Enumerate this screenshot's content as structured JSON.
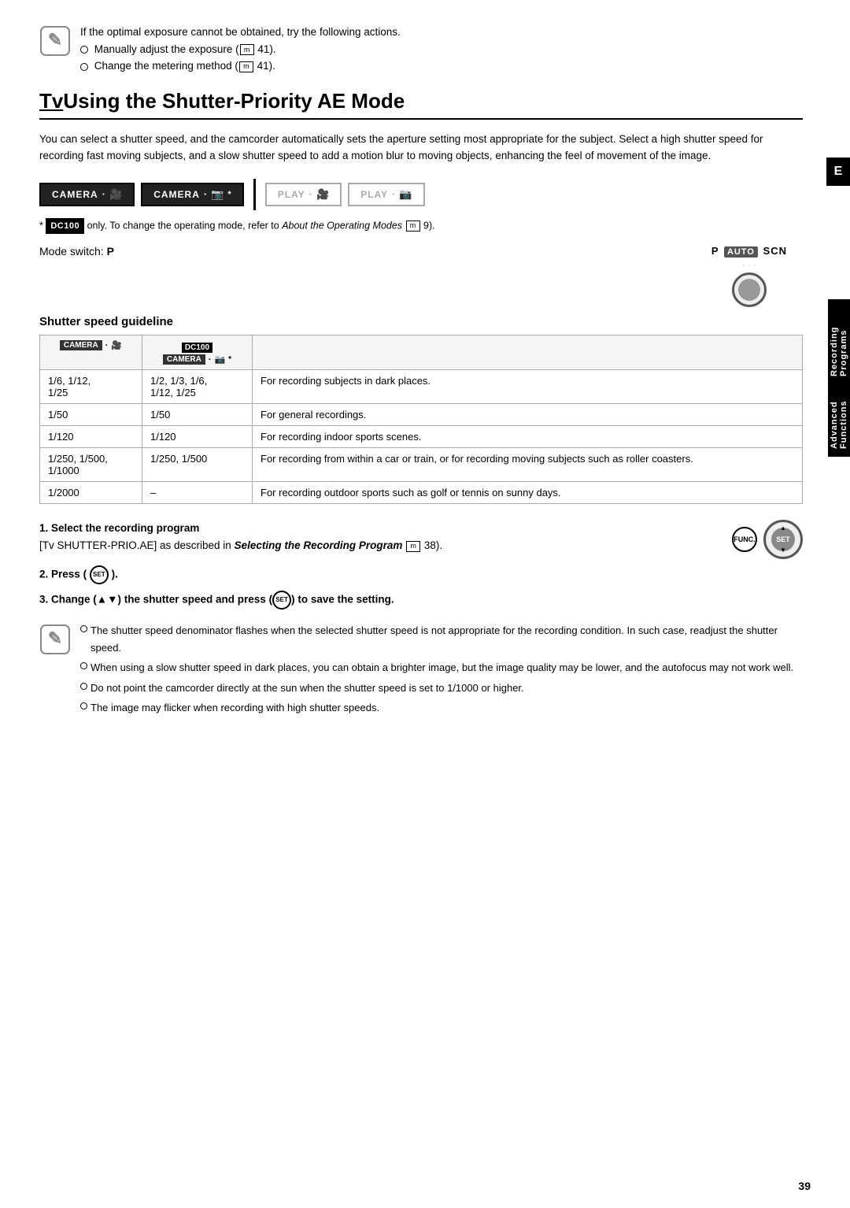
{
  "page": {
    "number": "39"
  },
  "etab": "E",
  "top_note": {
    "text1": "If the optimal exposure cannot be obtained, try the following actions.",
    "bullet1": "Manually adjust the exposure (",
    "ref1": "m",
    "num1": " 41).",
    "bullet2": "Change the metering method (",
    "ref2": "m",
    "num2": " 41)."
  },
  "title": {
    "tv_prefix": "Tv",
    "main": "Using the Shutter-Priority AE Mode"
  },
  "intro": "You can select a shutter speed, and the camcorder automatically sets the aperture setting most appropriate for the subject. Select a high shutter speed for recording fast moving subjects, and a slow shutter speed to add a motion blur to moving objects, enhancing the feel of movement of the image.",
  "mode_buttons": {
    "btn1_label": "CAMERA",
    "btn1_icon": "🎥",
    "btn2_label": "CAMERA",
    "btn2_icon": "📷",
    "btn3_label": "PLAY",
    "btn3_icon": "🎥",
    "btn4_label": "PLAY",
    "btn4_icon": "📷",
    "asterisk": "*"
  },
  "footnote": {
    "dc100": "DC100",
    "text": " only. To change the operating mode, refer to ",
    "italic": "About the Operating Modes",
    "ref": "m",
    "num": " 9).",
    "open_paren": "("
  },
  "mode_switch": {
    "label": "Mode switch: ",
    "p": "P",
    "p_auto_scn": "P AUTO SCN",
    "auto": "AUTO"
  },
  "shutter_section": {
    "heading": "Shutter speed guideline",
    "col1_header": "CAMERA · 🎥",
    "col2_dc": "DC100",
    "col2_header": "CAMERA · 📷*",
    "col3_header": "",
    "rows": [
      {
        "col1": "1/6, 1/12,\n1/25",
        "col2": "1/2, 1/3, 1/6,\n1/12, 1/25",
        "col3": "For recording subjects in dark places."
      },
      {
        "col1": "1/50",
        "col2": "1/50",
        "col3": "For general recordings."
      },
      {
        "col1": "1/120",
        "col2": "1/120",
        "col3": "For recording indoor sports scenes."
      },
      {
        "col1": "1/250, 1/500,\n1/1000",
        "col2": "1/250, 1/500",
        "col3": "For recording from within a car or train, or for recording moving subjects such as roller coasters."
      },
      {
        "col1": "1/2000",
        "col2": "–",
        "col3": "For recording outdoor sports such as golf or tennis on sunny days."
      }
    ]
  },
  "steps": {
    "step1_num": "1.",
    "step1_bold": "Select the recording program",
    "step1_bracket": "[Tv SHUTTER-PRIO.AE] as described in ",
    "step1_italic": "Selecting the Recording Program",
    "step1_ref": "m",
    "step1_num_ref": " 38).",
    "step1_open": "(",
    "step2_num": "2.",
    "step2_text": "Press (",
    "step2_set": "SET",
    "step2_close": ").",
    "step3_num": "3.",
    "step3_text1": "Change (",
    "step3_arrows": "▲▼",
    "step3_text2": ") the shutter speed and press (",
    "step3_set": "SET",
    "step3_text3": ") to save the setting.",
    "func_label": "FUNC.",
    "set_label": "SET"
  },
  "bottom_notes": {
    "bullets": [
      "The shutter speed denominator flashes when the selected shutter speed is not appropriate for the recording condition. In such case, readjust the shutter speed.",
      "When using a slow shutter speed in dark places, you can obtain a brighter image, but the image quality may be lower, and the autofocus may not work well.",
      "Do not point the camcorder directly at the sun when the shutter speed is set to 1/1000 or higher.",
      "The image may flicker when recording with high shutter speeds."
    ]
  },
  "right_sidebar": {
    "line1": "Advanced Functions",
    "line2": "Recording Programs"
  }
}
